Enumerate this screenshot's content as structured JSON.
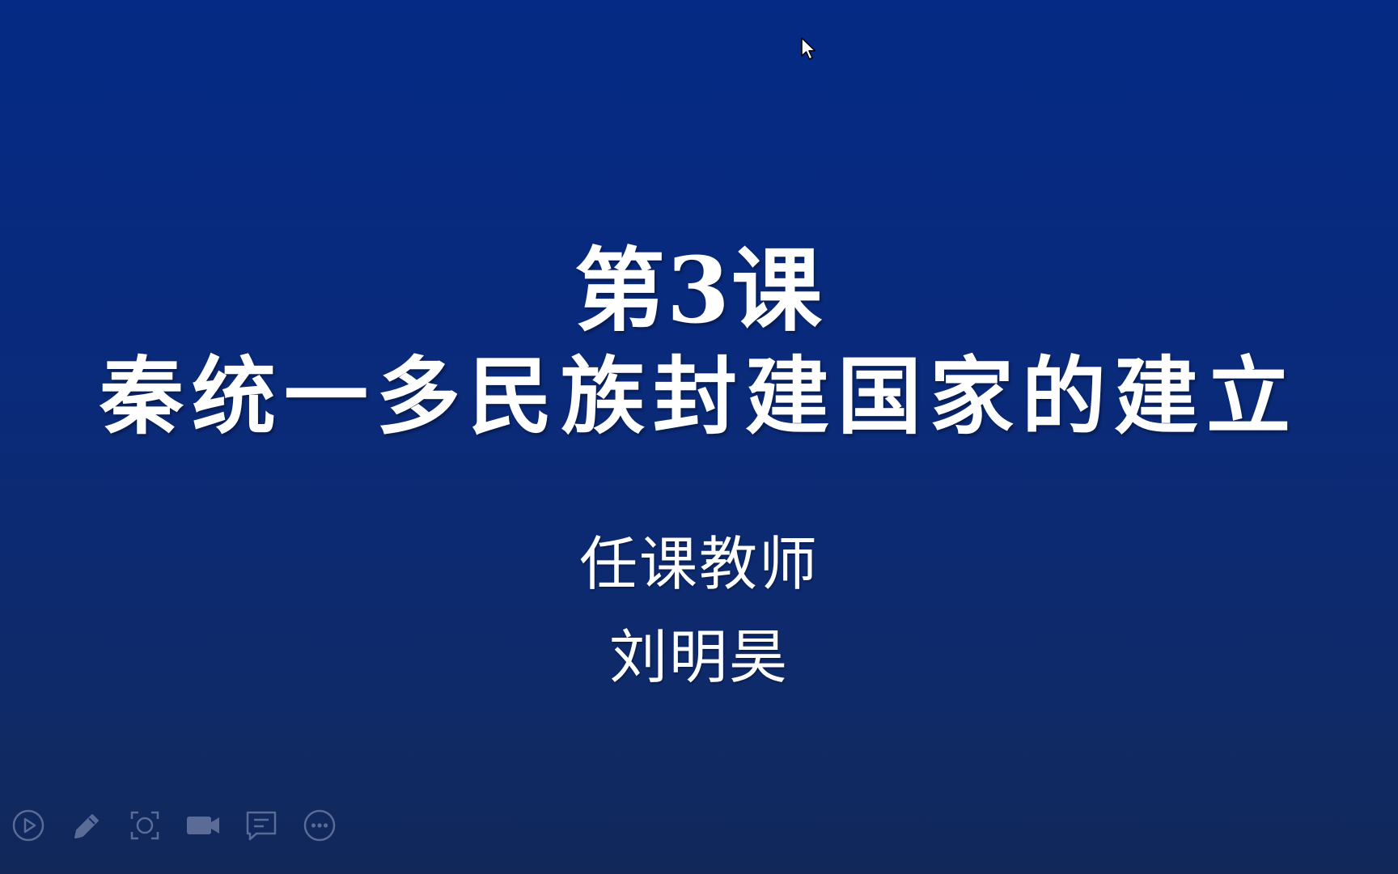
{
  "slide": {
    "title_line1": "第3课",
    "title_line2": "秦统一多民族封建国家的建立",
    "teacher_label": "任课教师",
    "teacher_name": "刘明昊"
  },
  "toolbar": {
    "items": [
      {
        "icon": "play-icon"
      },
      {
        "icon": "pen-icon"
      },
      {
        "icon": "screenshot-icon"
      },
      {
        "icon": "camera-icon"
      },
      {
        "icon": "comment-icon"
      },
      {
        "icon": "more-icon"
      }
    ]
  },
  "colors": {
    "background_top": "#042a85",
    "background_bottom": "#112859",
    "text": "#ffffff",
    "toolbar_icon": "#5a6b96"
  }
}
